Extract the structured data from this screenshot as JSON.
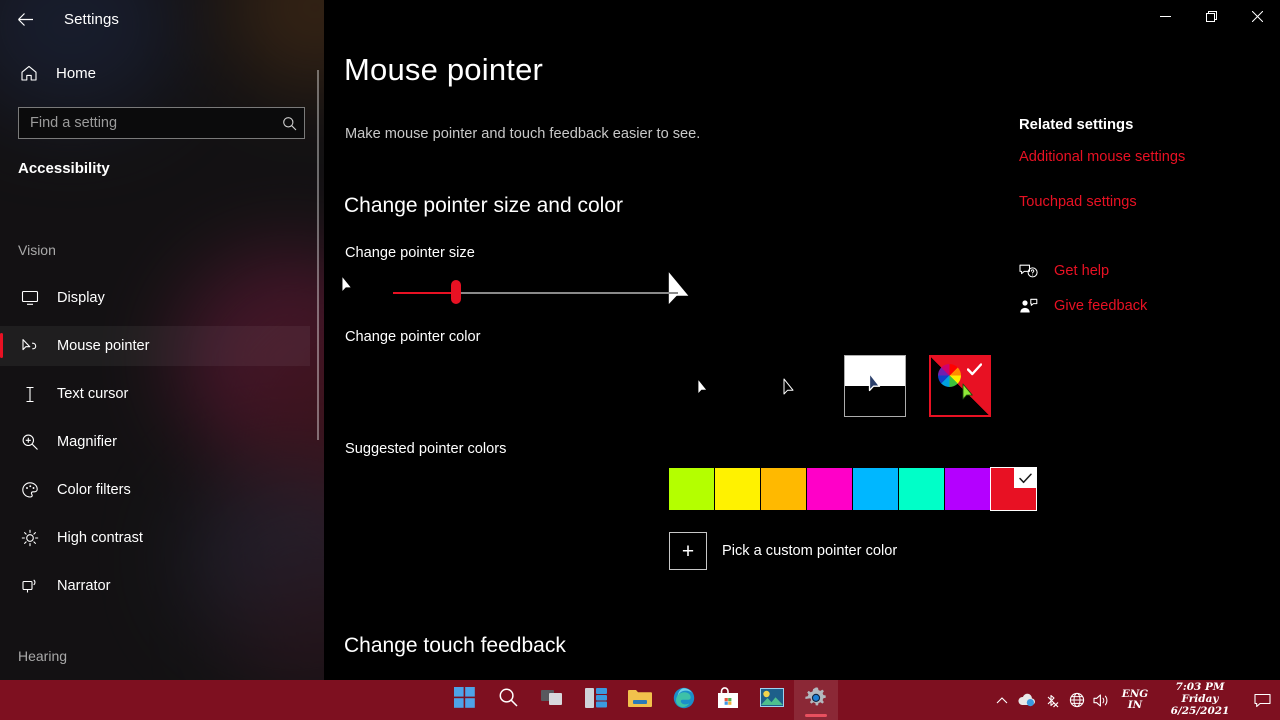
{
  "window": {
    "app_title": "Settings",
    "back_icon": "back-arrow-icon",
    "controls": {
      "minimize": "minimize-icon",
      "restore": "restore-icon",
      "close": "close-icon"
    }
  },
  "sidebar": {
    "home_label": "Home",
    "home_icon": "home-icon",
    "search": {
      "placeholder": "Find a setting",
      "value": "",
      "icon": "search-icon"
    },
    "category": "Accessibility",
    "groups": [
      {
        "label": "Vision"
      },
      {
        "label": "Hearing"
      }
    ],
    "items": [
      {
        "label": "Display",
        "icon": "monitor-icon",
        "selected": false
      },
      {
        "label": "Mouse pointer",
        "icon": "mouse-pointer-icon",
        "selected": true
      },
      {
        "label": "Text cursor",
        "icon": "text-cursor-icon",
        "selected": false
      },
      {
        "label": "Magnifier",
        "icon": "magnifier-icon",
        "selected": false
      },
      {
        "label": "Color filters",
        "icon": "palette-icon",
        "selected": false
      },
      {
        "label": "High contrast",
        "icon": "brightness-icon",
        "selected": false
      },
      {
        "label": "Narrator",
        "icon": "narrator-icon",
        "selected": false
      }
    ]
  },
  "main": {
    "page_title": "Mouse pointer",
    "page_subtitle": "Make mouse pointer and touch feedback easier to see.",
    "sections": {
      "size_and_color": "Change pointer size and color",
      "touch_feedback": "Change touch feedback"
    },
    "pointer_size": {
      "label": "Change pointer size",
      "value": 22,
      "min": 0,
      "max": 100,
      "small_icon": "cursor-small-icon",
      "large_icon": "cursor-large-icon"
    },
    "pointer_color": {
      "label": "Change pointer color",
      "options": [
        {
          "name": "white-pointer",
          "selected": false
        },
        {
          "name": "black-pointer",
          "selected": false
        },
        {
          "name": "inverted-pointer",
          "selected": false
        },
        {
          "name": "custom-pointer",
          "selected": true
        }
      ]
    },
    "suggested_colors": {
      "label": "Suggested pointer colors",
      "swatches": [
        {
          "name": "chartreuse",
          "hex": "#B4FF00",
          "selected": false
        },
        {
          "name": "yellow",
          "hex": "#FFF200",
          "selected": false
        },
        {
          "name": "orange",
          "hex": "#FFB900",
          "selected": false
        },
        {
          "name": "magenta",
          "hex": "#FF00C8",
          "selected": false
        },
        {
          "name": "cyan",
          "hex": "#00B7FF",
          "selected": false
        },
        {
          "name": "spring",
          "hex": "#00FFC8",
          "selected": false
        },
        {
          "name": "purple",
          "hex": "#B400FF",
          "selected": false
        },
        {
          "name": "red",
          "hex": "#E81123",
          "selected": true
        }
      ]
    },
    "pick_custom": {
      "label": "Pick a custom pointer color",
      "icon": "plus-icon"
    }
  },
  "rail": {
    "title": "Related settings",
    "links": [
      {
        "label": "Additional mouse settings"
      },
      {
        "label": "Touchpad settings"
      }
    ],
    "support": [
      {
        "label": "Get help",
        "icon": "help-chat-icon"
      },
      {
        "label": "Give feedback",
        "icon": "feedback-person-icon"
      }
    ]
  },
  "taskbar": {
    "buttons": [
      {
        "name": "start-button",
        "icon": "windows-logo-icon",
        "active": false
      },
      {
        "name": "search-button",
        "icon": "search-icon",
        "active": false
      },
      {
        "name": "task-view-button",
        "icon": "task-view-icon",
        "active": false
      },
      {
        "name": "widgets-button",
        "icon": "widgets-icon",
        "active": false
      },
      {
        "name": "file-explorer-button",
        "icon": "folder-icon",
        "active": false
      },
      {
        "name": "edge-button",
        "icon": "edge-icon",
        "active": false
      },
      {
        "name": "store-button",
        "icon": "store-icon",
        "active": false
      },
      {
        "name": "photos-button",
        "icon": "photos-icon",
        "active": false
      },
      {
        "name": "settings-button",
        "icon": "gear-icon",
        "active": true
      }
    ],
    "tray": {
      "chevron": "chevron-up-icon",
      "icons": [
        "onedrive-icon",
        "no-bluetooth-icon",
        "network-globe-icon",
        "volume-icon"
      ],
      "language": {
        "line1": "ENG",
        "line2": "IN"
      },
      "clock": {
        "time": "7:03 PM",
        "day": "Friday",
        "date": "6/25/2021"
      },
      "notifications": "notification-icon"
    }
  },
  "colors": {
    "accent": "#E81123",
    "taskbar": "#7E1020",
    "background": "#000000"
  }
}
